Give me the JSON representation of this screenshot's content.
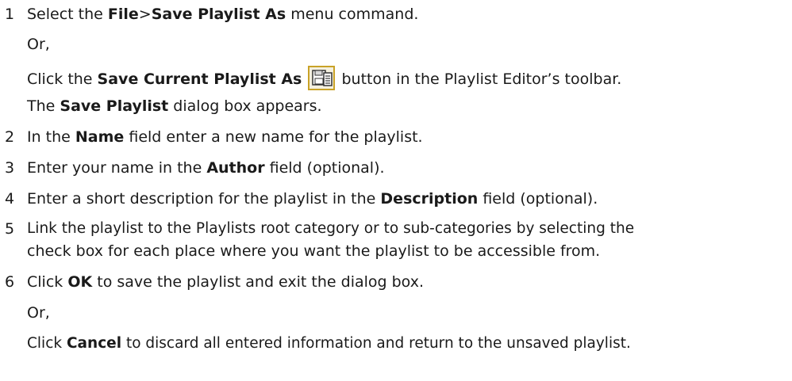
{
  "steps": [
    {
      "num": "1",
      "pre": "Select the ",
      "b1": "File",
      "mid": ">",
      "b2": "Save Playlist As",
      "post": " menu command."
    },
    {
      "or": "Or,"
    },
    {
      "pre": "Click the ",
      "b1": "Save Current Playlist As",
      "icon": "save-playlist-icon",
      "post": " button in the Playlist Editor’s toolbar."
    },
    {
      "pre": "The ",
      "b1": "Save Playlist",
      "post": " dialog box appears."
    },
    {
      "num": "2",
      "pre": "In the ",
      "b1": "Name",
      "post": " field enter a new name for the playlist."
    },
    {
      "num": "3",
      "pre": "Enter your name in the ",
      "b1": "Author",
      "post": " field (optional)."
    },
    {
      "num": "4",
      "pre": "Enter a short description for the playlist in the ",
      "b1": "Description",
      "post": " field (optional)."
    },
    {
      "num": "5",
      "line1": "Link the playlist to the Playlists root category or to sub-categories by selecting the",
      "line2": "check box for each place where you want the playlist to be accessible from."
    },
    {
      "num": "6",
      "pre": "Click ",
      "b1": "OK",
      "post": " to save the playlist and exit the dialog box."
    },
    {
      "or": "Or,"
    },
    {
      "pre": "Click ",
      "b1": "Cancel",
      "post": " to discard all entered information and return to the unsaved playlist."
    }
  ]
}
